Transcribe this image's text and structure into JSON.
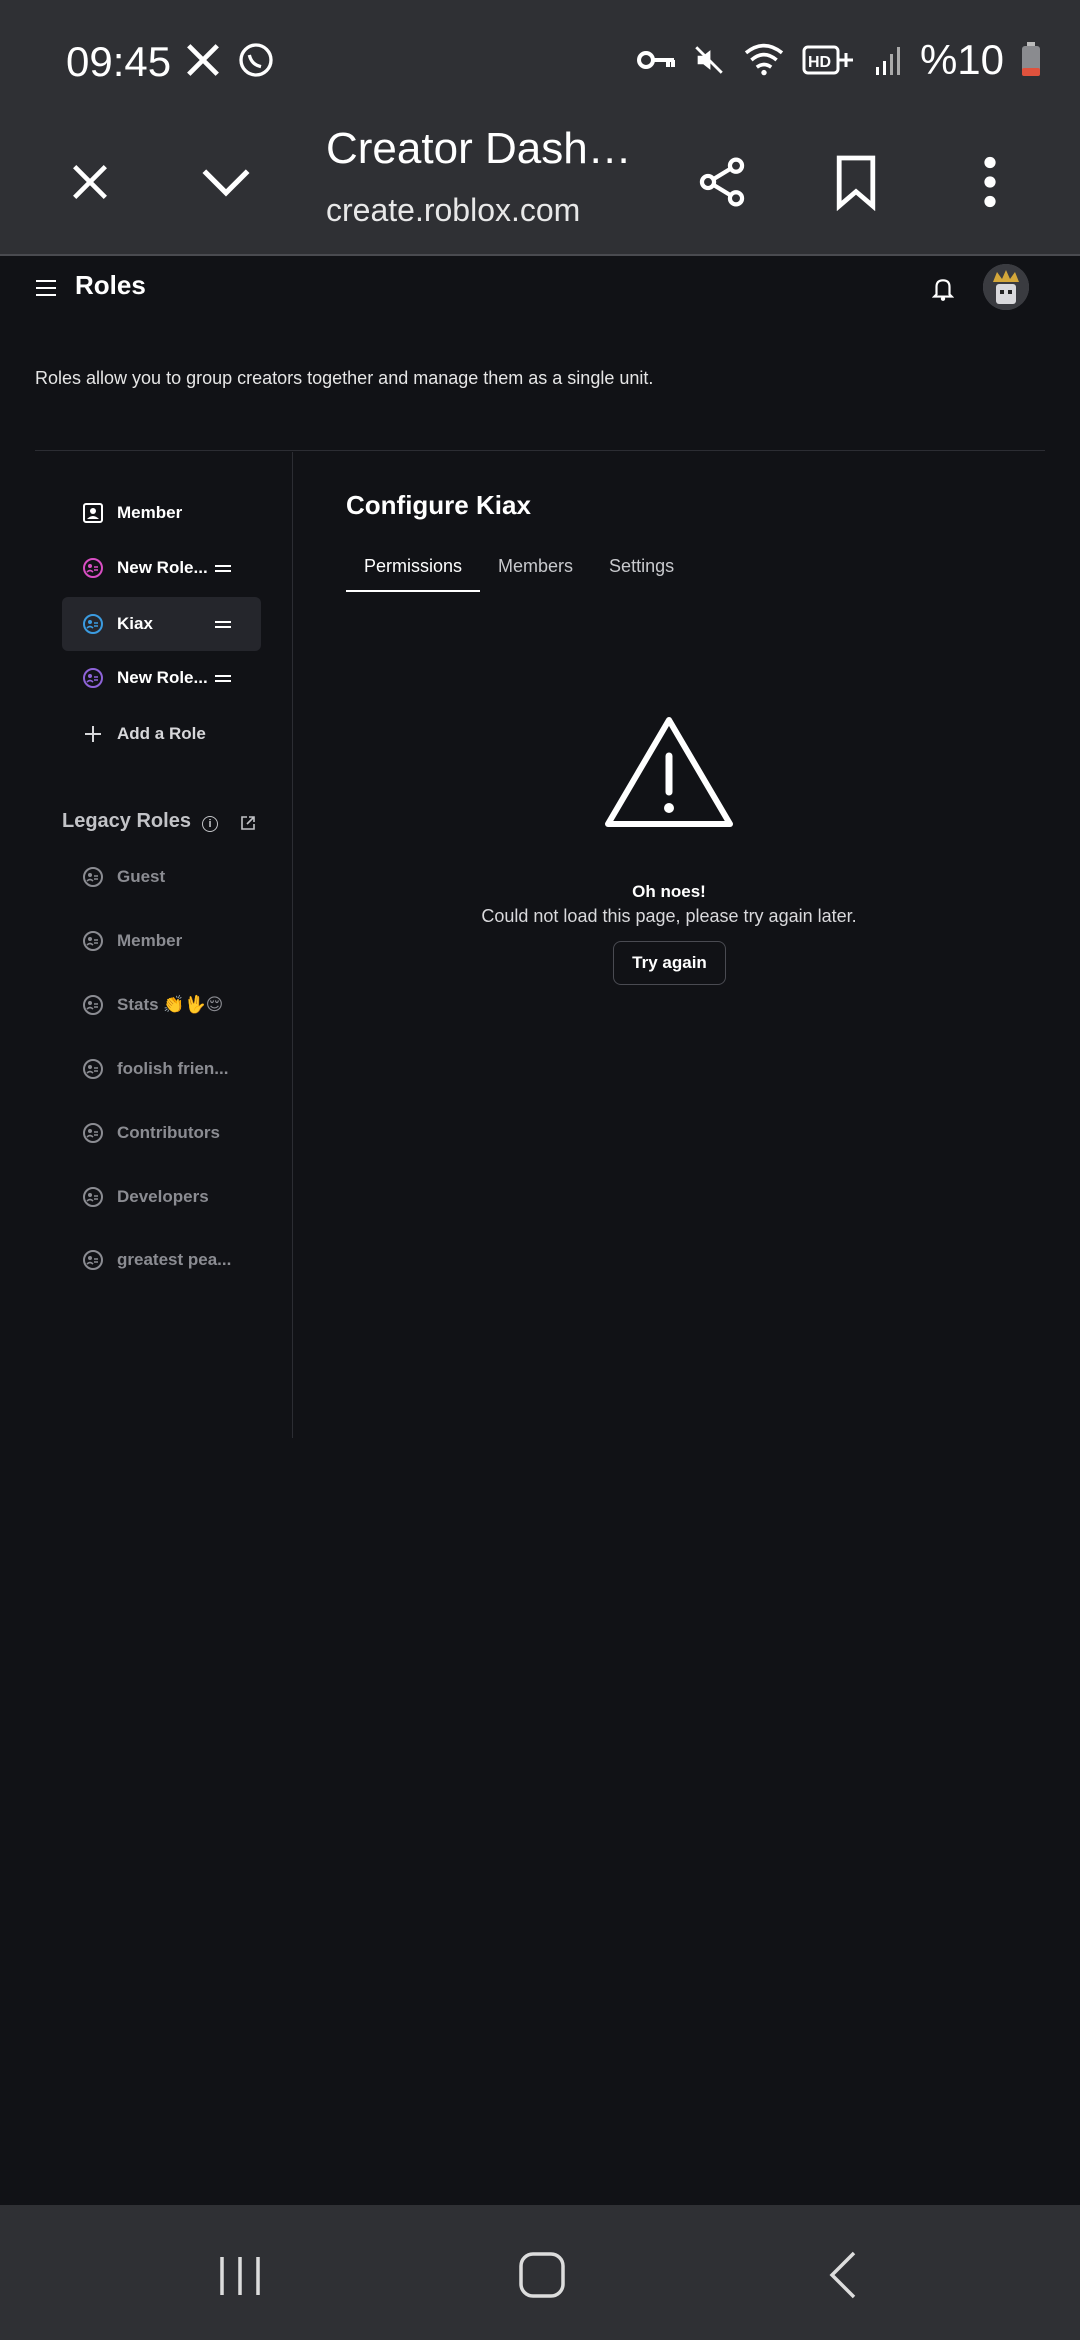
{
  "status_bar": {
    "time": "09:45",
    "battery_text": "%10",
    "icons": [
      "x-app-icon",
      "whatsapp-icon",
      "vpn-key-icon",
      "mute-icon",
      "wifi-icon",
      "hd-plus-icon",
      "signal-icon",
      "battery-icon"
    ]
  },
  "browser": {
    "title": "Creator Dashb…",
    "url": "create.roblox.com"
  },
  "header": {
    "title": "Roles",
    "intro": "Roles allow you to group creators together and manage them as a single unit."
  },
  "sidebar": {
    "roles": [
      {
        "label": "Member",
        "icon": "member-icon",
        "color": "#ffffff"
      },
      {
        "label": "New Role...",
        "icon": "role-icon",
        "color": "#d84ec3"
      },
      {
        "label": "Kiax",
        "icon": "role-icon",
        "color": "#3b9be0"
      },
      {
        "label": "New Role...",
        "icon": "role-icon",
        "color": "#8e63d8"
      }
    ],
    "add_role": "Add a Role",
    "legacy_title": "Legacy Roles",
    "legacy_roles": [
      {
        "label": "Guest"
      },
      {
        "label": "Member"
      },
      {
        "label": "Stats 👏🖖😌"
      },
      {
        "label": "foolish frien..."
      },
      {
        "label": "Contributors"
      },
      {
        "label": "Developers"
      },
      {
        "label": "greatest pea..."
      }
    ]
  },
  "main": {
    "title": "Configure Kiax",
    "tabs": [
      "Permissions",
      "Members",
      "Settings"
    ],
    "active_tab": "Permissions",
    "error_title": "Oh noes!",
    "error_message": "Could not load this page, please try again later.",
    "retry_label": "Try again"
  }
}
